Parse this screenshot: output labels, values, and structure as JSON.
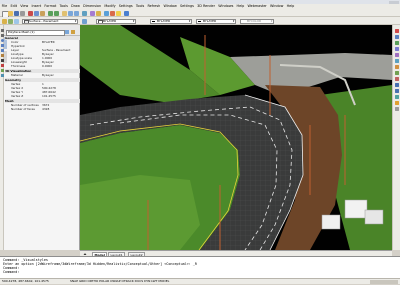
{
  "menu": [
    "File",
    "Edit",
    "View",
    "Insert",
    "Format",
    "Tools",
    "Draw",
    "Dimension",
    "Modify",
    "Settings",
    "Tools",
    "Refresh",
    "Window",
    "Settings",
    "3D Render",
    "Windows",
    "Help",
    "Webmaster",
    "Window",
    "Help"
  ],
  "toolbar": {
    "layer_dropdown": "Surface - Pavement",
    "color_dropdown": "BYLAYER",
    "linetype_dropdown": "BYLAYER",
    "lineweight_dropdown": "BYLAYER",
    "plotstyle_dropdown": "BYCOLOR"
  },
  "properties": {
    "selector": "Polyface Mesh (1)",
    "sections": [
      {
        "title": "General",
        "rows": [
          {
            "k": "Color",
            "v": "BYLAYER"
          },
          {
            "k": "Hyperlink",
            "v": ""
          },
          {
            "k": "Layer",
            "v": "Surface - Pavement"
          },
          {
            "k": "Linetype",
            "v": "ByLayer"
          },
          {
            "k": "Linetype scale",
            "v": "1.0000"
          },
          {
            "k": "Lineweight",
            "v": "ByLayer"
          },
          {
            "k": "Thickness",
            "v": "0.0000"
          }
        ]
      },
      {
        "title": "3D Visualization",
        "rows": [
          {
            "k": "Material",
            "v": "ByLayer"
          }
        ]
      },
      {
        "title": "Geometry",
        "rows": [
          {
            "k": "Vertex",
            "v": "1"
          },
          {
            "k": "Vertex X",
            "v": "590.4278"
          },
          {
            "k": "Vertex Y",
            "v": "487.6642"
          },
          {
            "k": "Vertex Z",
            "v": "101.4575"
          }
        ]
      },
      {
        "title": "Mesh",
        "rows": [
          {
            "k": "Number of vertices",
            "v": "3672"
          },
          {
            "k": "Number of faces",
            "v": "4328"
          }
        ]
      }
    ]
  },
  "tabs": [
    "Model",
    "Layout1",
    "Layout2"
  ],
  "command": [
    "Command: _Visualstyles",
    "Enter an option [2dWireframe/3dWireframe/3d Hidden/Realistic/Conceptual/Other] <Conceptual>: _R",
    "Command:",
    "Command:"
  ],
  "status": {
    "coords": "590.4278, 487.6642, 101.4575",
    "modes": "SNAP  GRID  ORTHO  POLAR  OSNAP  OTRACK  DUCS  DYN  LWT  MODEL"
  },
  "colors": {
    "grass": "#4f8a2a",
    "asphalt": "#3a3b3b",
    "terrain": "#6d4528",
    "concrete": "#9d9e99",
    "background": "#010101"
  }
}
